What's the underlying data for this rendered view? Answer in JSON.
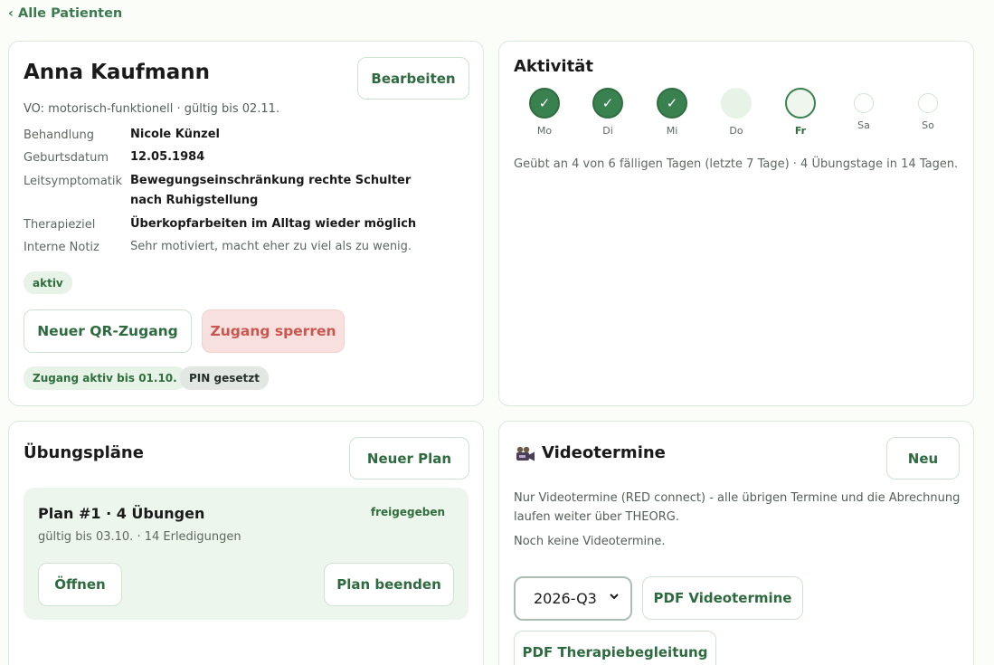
{
  "nav": {
    "back_label": "‹ Alle Patienten"
  },
  "patient": {
    "name": "Anna Kaufmann",
    "edit_label": "Bearbeiten",
    "vo": "VO: motorisch-funktionell · gültig bis 02.11.",
    "fields": [
      {
        "label": "Behandlung",
        "value": "Nicole Künzel"
      },
      {
        "label": "Geburtsdatum",
        "value": "12.05.1984"
      },
      {
        "label": "Leitsymptomatik",
        "value": "Bewegungseinschränkung rechte Schulter nach Ruhigstellung"
      },
      {
        "label": "Therapieziel",
        "value": "Überkopfarbeiten im Alltag wieder möglich"
      },
      {
        "label": "Interne Notiz",
        "value": "Sehr motiviert, macht eher zu viel als zu wenig."
      }
    ],
    "status_badge": "aktiv",
    "qr_button": "Neuer QR-Zugang",
    "lock_button": "Zugang sperren",
    "access_badge": "Zugang aktiv bis 01.10.",
    "pin_badge": "PIN gesetzt"
  },
  "activity": {
    "title": "Aktivität",
    "days": [
      {
        "label": "Mo",
        "state": "done",
        "mark": "✓"
      },
      {
        "label": "Di",
        "state": "done",
        "mark": "✓"
      },
      {
        "label": "Mi",
        "state": "done",
        "mark": "✓"
      },
      {
        "label": "Do",
        "state": "missed",
        "mark": ""
      },
      {
        "label": "Fr",
        "state": "today",
        "mark": ""
      },
      {
        "label": "Sa",
        "state": "future",
        "mark": ""
      },
      {
        "label": "So",
        "state": "future",
        "mark": ""
      }
    ],
    "summary": "Geübt an 4 von 6 fälligen Tagen (letzte 7 Tage) · 4 Übungstage in 14 Tagen."
  },
  "plans": {
    "title": "Übungspläne",
    "new_button": "Neuer Plan",
    "plan": {
      "title": "Plan #1 · 4 Übungen",
      "status": "freigegeben",
      "meta": "gültig bis 03.10. · 14 Erledigungen",
      "open_button": "Öffnen",
      "end_button": "Plan beenden"
    }
  },
  "video": {
    "title": "Videotermine",
    "new_button": "Neu",
    "description": "Nur Videotermine (RED connect) - alle übrigen Termine und die Abrechnung laufen weiter über THEORG.",
    "empty": "Noch keine Videotermine.",
    "quarter_selected": "2026-Q3",
    "pdf_video_button": "PDF Videotermine",
    "pdf_therapy_button": "PDF Therapiebegleitung"
  },
  "colors": {
    "accent": "#3a8150",
    "accent_text": "#2e6a40",
    "danger_bg": "#f7e0de",
    "danger_text": "#c9564f",
    "plan_bg": "#edf6ec"
  }
}
